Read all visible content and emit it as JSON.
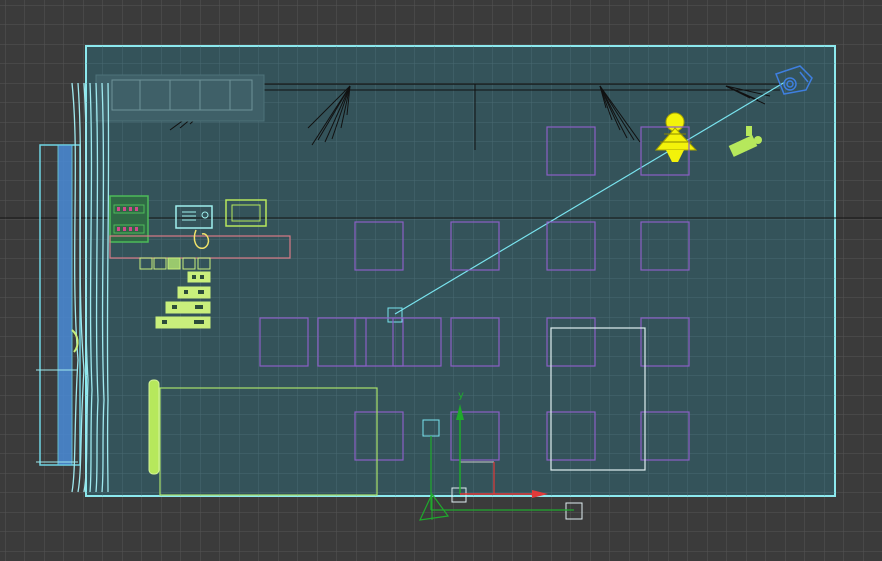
{
  "viewport": {
    "axis_label_y": "y"
  },
  "colors": {
    "background": "#3b3b3b",
    "grid": "#4f4f4f",
    "room_fill": "#34535a",
    "room_outline": "#8ce9ee",
    "cube_outline": "#8a5fc6",
    "camera": "#3e7fe0",
    "spot_cone": "#121212",
    "bright_yellow": "#f3f20a",
    "lime": "#b6e85c",
    "green_panel": "#4dbb59",
    "axis_green": "#1faa2c",
    "axis_red": "#e23a3a"
  },
  "icons": {
    "camera": "camera-icon",
    "light_bulb": "light-bulb-icon",
    "flashlight": "flashlight-icon",
    "gizmo": "transform-gizmo-icon"
  }
}
